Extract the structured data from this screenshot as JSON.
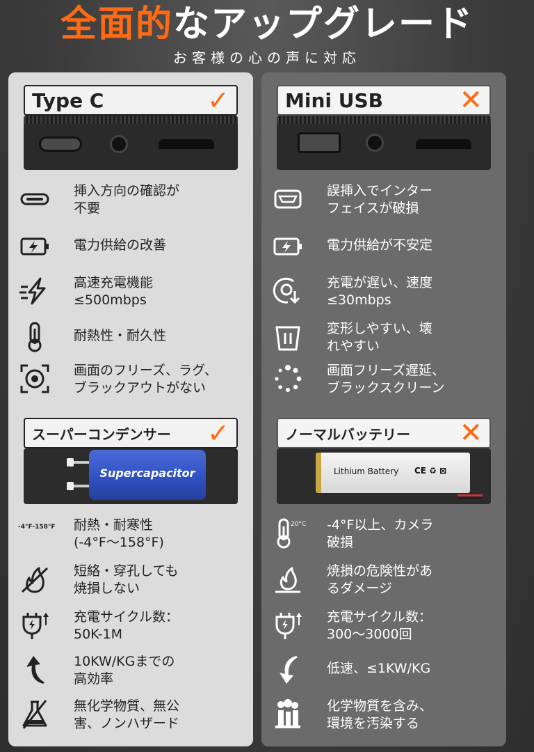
{
  "header": {
    "title_orange": "全面的",
    "title_white": "なアップグレード",
    "subtitle": "お客様の心の声に対応"
  },
  "colors": {
    "accent": "#ff6a13",
    "left_panel": "#dcdcdc",
    "right_panel": "#6b6b6b"
  },
  "left": {
    "port_header": "Type C",
    "port_mark": "✓",
    "port_icons": [
      "usb-c-port",
      "audio-jack",
      "tf-card-slot"
    ],
    "items": [
      {
        "icon": "usb-c-icon",
        "lines": [
          "挿入方向の確認が",
          "不要"
        ]
      },
      {
        "icon": "battery-charge-icon",
        "lines": [
          "電力供給の改善"
        ]
      },
      {
        "icon": "fast-charge-icon",
        "lines": [
          "高速充電機能",
          "≤500mbps"
        ]
      },
      {
        "icon": "thermometer-icon",
        "lines": [
          "耐熱性・耐久性"
        ]
      },
      {
        "icon": "focus-target-icon",
        "lines": [
          "画面のフリーズ、ラグ、",
          "ブラックアウトがない"
        ]
      }
    ],
    "battery_header": "スーパーコンデンサー",
    "battery_mark": "✓",
    "battery_product_text": "Supercapacitor",
    "battery_items": [
      {
        "icon": "temperature-range-icon",
        "icon_text": "-4°F-158°F",
        "lines": [
          "耐熱・耐寒性",
          "(-4°F～158°F)"
        ]
      },
      {
        "icon": "no-fire-icon",
        "lines": [
          "短絡・穿孔しても",
          "焼損しない"
        ]
      },
      {
        "icon": "charge-cycle-icon",
        "lines": [
          "充電サイクル数：",
          "50K-1M"
        ]
      },
      {
        "icon": "arrow-up-icon",
        "lines": [
          "10KW/KGまでの",
          "高効率"
        ]
      },
      {
        "icon": "no-chemical-icon",
        "lines": [
          "無化学物質、無公",
          "害、ノンハザード"
        ]
      }
    ]
  },
  "right": {
    "port_header": "Mini USB",
    "port_mark": "✕",
    "port_icons": [
      "mini-usb-port",
      "audio-jack",
      "tf-card-slot"
    ],
    "items": [
      {
        "icon": "mini-usb-icon",
        "lines": [
          "誤挿入でインター",
          "フェイスが破損"
        ]
      },
      {
        "icon": "battery-charge-icon",
        "lines": [
          "電力供給が不安定"
        ]
      },
      {
        "icon": "slow-download-icon",
        "lines": [
          "充電が遅い、速度",
          "≤30mbps"
        ]
      },
      {
        "icon": "deform-icon",
        "lines": [
          "変形しやすい、壊",
          "れやすい"
        ]
      },
      {
        "icon": "loading-spinner-icon",
        "lines": [
          "画面フリーズ遅延、",
          "ブラックスクリーン"
        ]
      }
    ],
    "battery_header": "ノーマルバッテリー",
    "battery_mark": "✕",
    "battery_product_text": "Lithium Battery",
    "battery_product_marks": "CE ♻ ⊠",
    "battery_items": [
      {
        "icon": "thermometer-icon",
        "icon_text": "20°C",
        "lines": [
          "-4°F以上、カメラ",
          "破損"
        ]
      },
      {
        "icon": "fire-icon",
        "lines": [
          "焼損の危険性があ",
          "るダメージ"
        ]
      },
      {
        "icon": "charge-cycle-icon",
        "lines": [
          "充電サイクル数：",
          "300〜3000回"
        ]
      },
      {
        "icon": "arrow-down-icon",
        "lines": [
          "低速、≤1KW/KG"
        ]
      },
      {
        "icon": "pollution-icon",
        "lines": [
          "化学物質を含み、",
          "環境を汚染する"
        ]
      }
    ]
  }
}
